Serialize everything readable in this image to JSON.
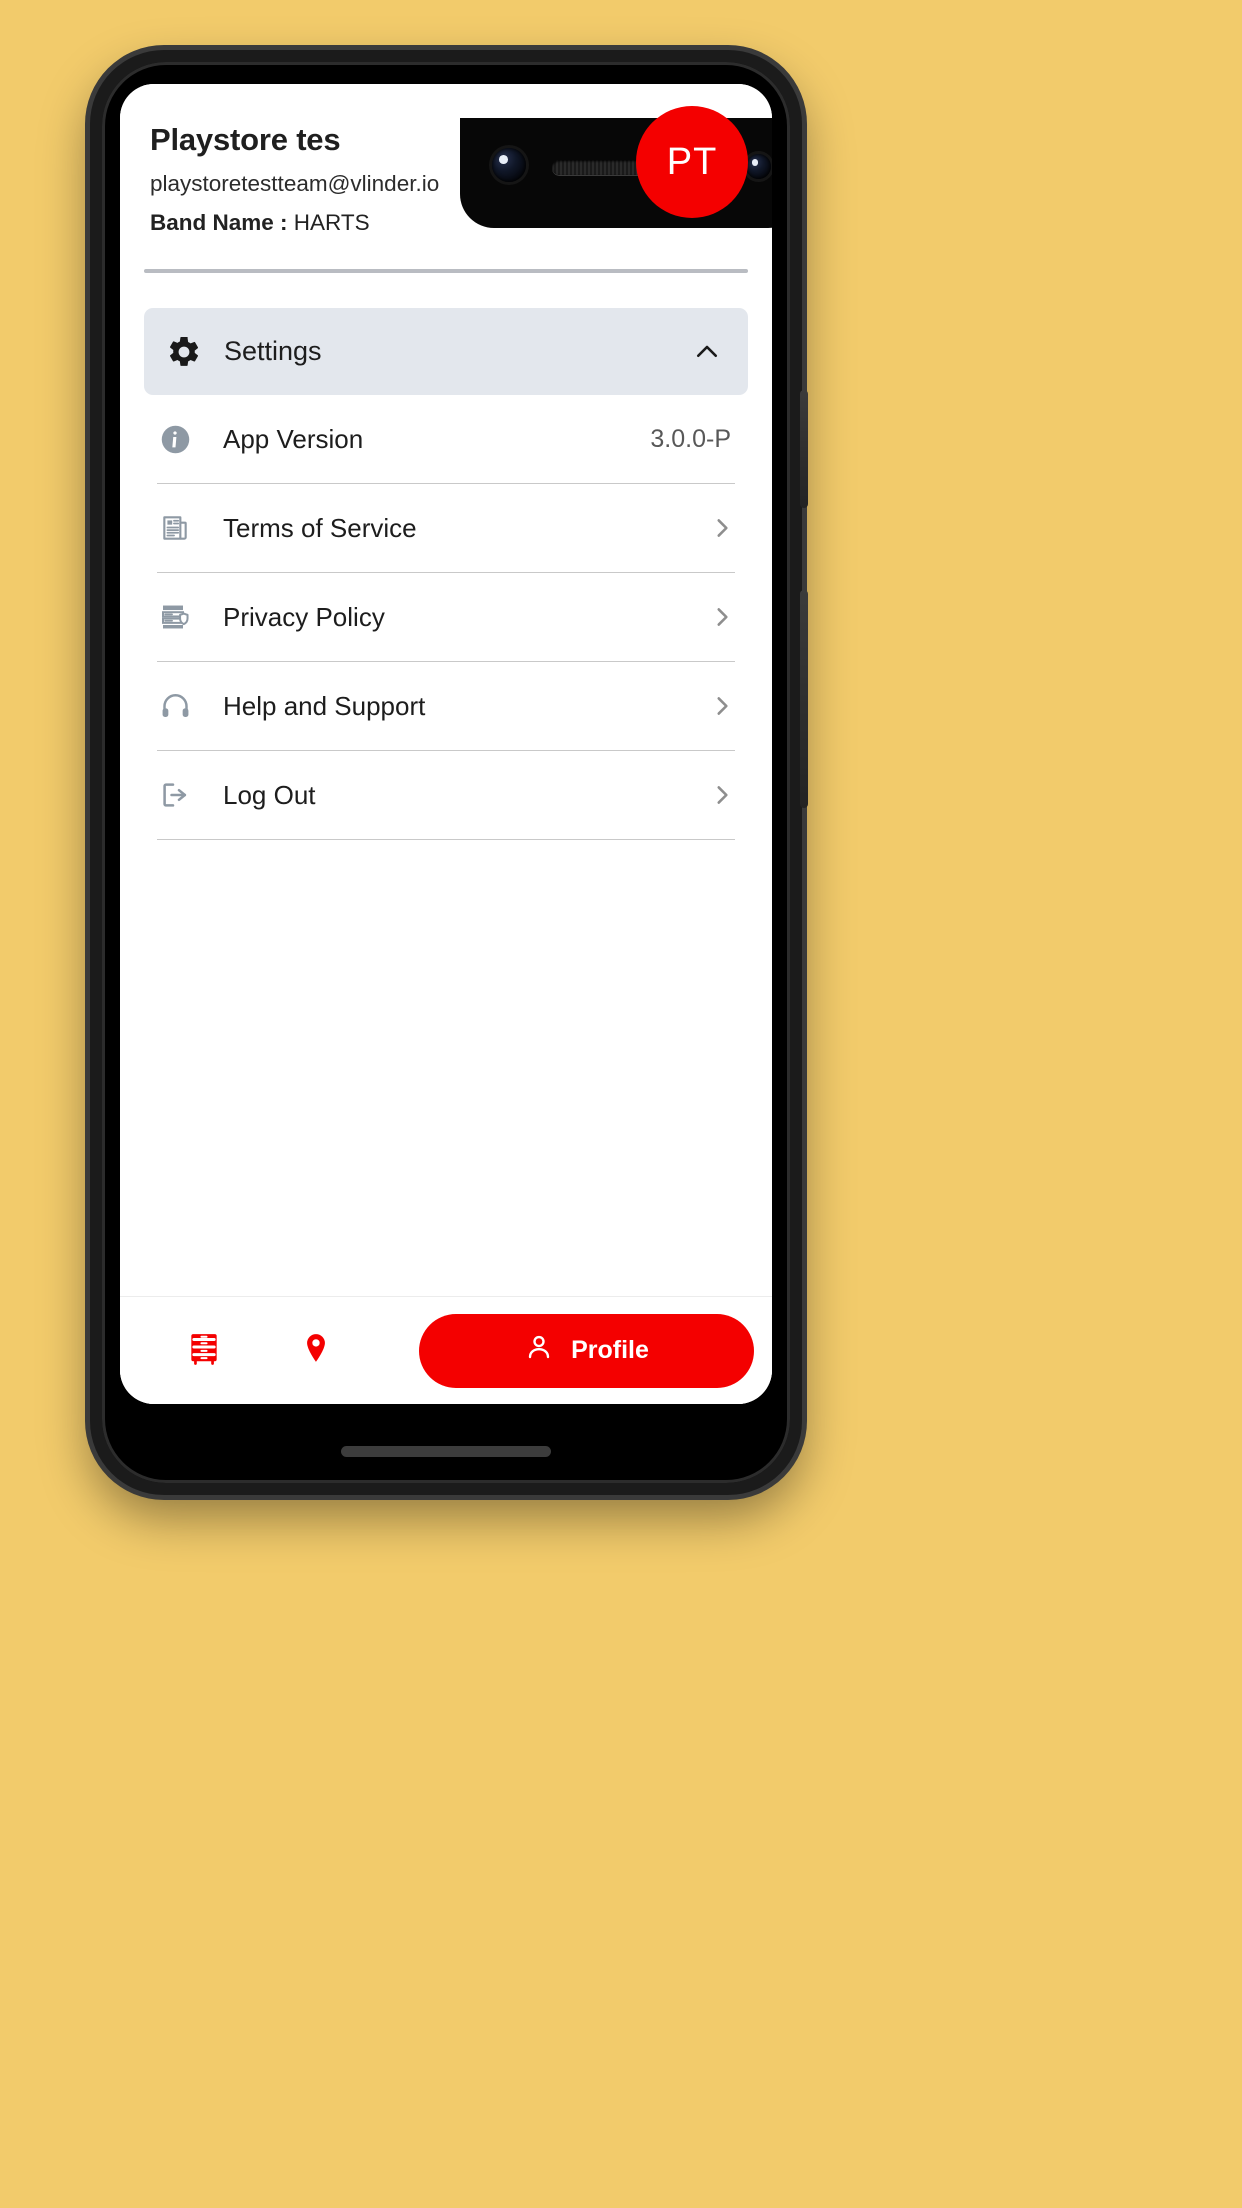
{
  "theme": {
    "page_background": "#F2CB6B",
    "accent_red": "#F40000",
    "settings_header_bg": "#E3E7ED",
    "icon_gray": "#8E99A4"
  },
  "profile": {
    "account_name": "Playstore tes",
    "email": "playstoretestteam@vlinder.io",
    "band_label": "Band Name :",
    "band_value": "HARTS",
    "avatar_initials": "PT"
  },
  "settings_section": {
    "title": "Settings",
    "gear_icon": "gear-icon",
    "toggle_icon": "chevron-up-icon",
    "expanded": true,
    "items": [
      {
        "label": "App Version",
        "icon": "info-circle-icon",
        "value": "3.0.0-P",
        "has_chevron": false
      },
      {
        "label": "Terms of Service",
        "icon": "document-article-icon",
        "value": "",
        "has_chevron": true
      },
      {
        "label": "Privacy Policy",
        "icon": "privacy-shield-list-icon",
        "value": "",
        "has_chevron": true
      },
      {
        "label": "Help and Support",
        "icon": "headset-icon",
        "value": "",
        "has_chevron": true
      },
      {
        "label": "Log Out",
        "icon": "logout-arrow-icon",
        "value": "",
        "has_chevron": true
      }
    ]
  },
  "bottom_nav": {
    "items": [
      {
        "icon": "drawer-cabinet-icon",
        "label": ""
      },
      {
        "icon": "location-pin-icon",
        "label": ""
      }
    ],
    "profile_button": {
      "label": "Profile",
      "icon": "person-icon"
    }
  }
}
